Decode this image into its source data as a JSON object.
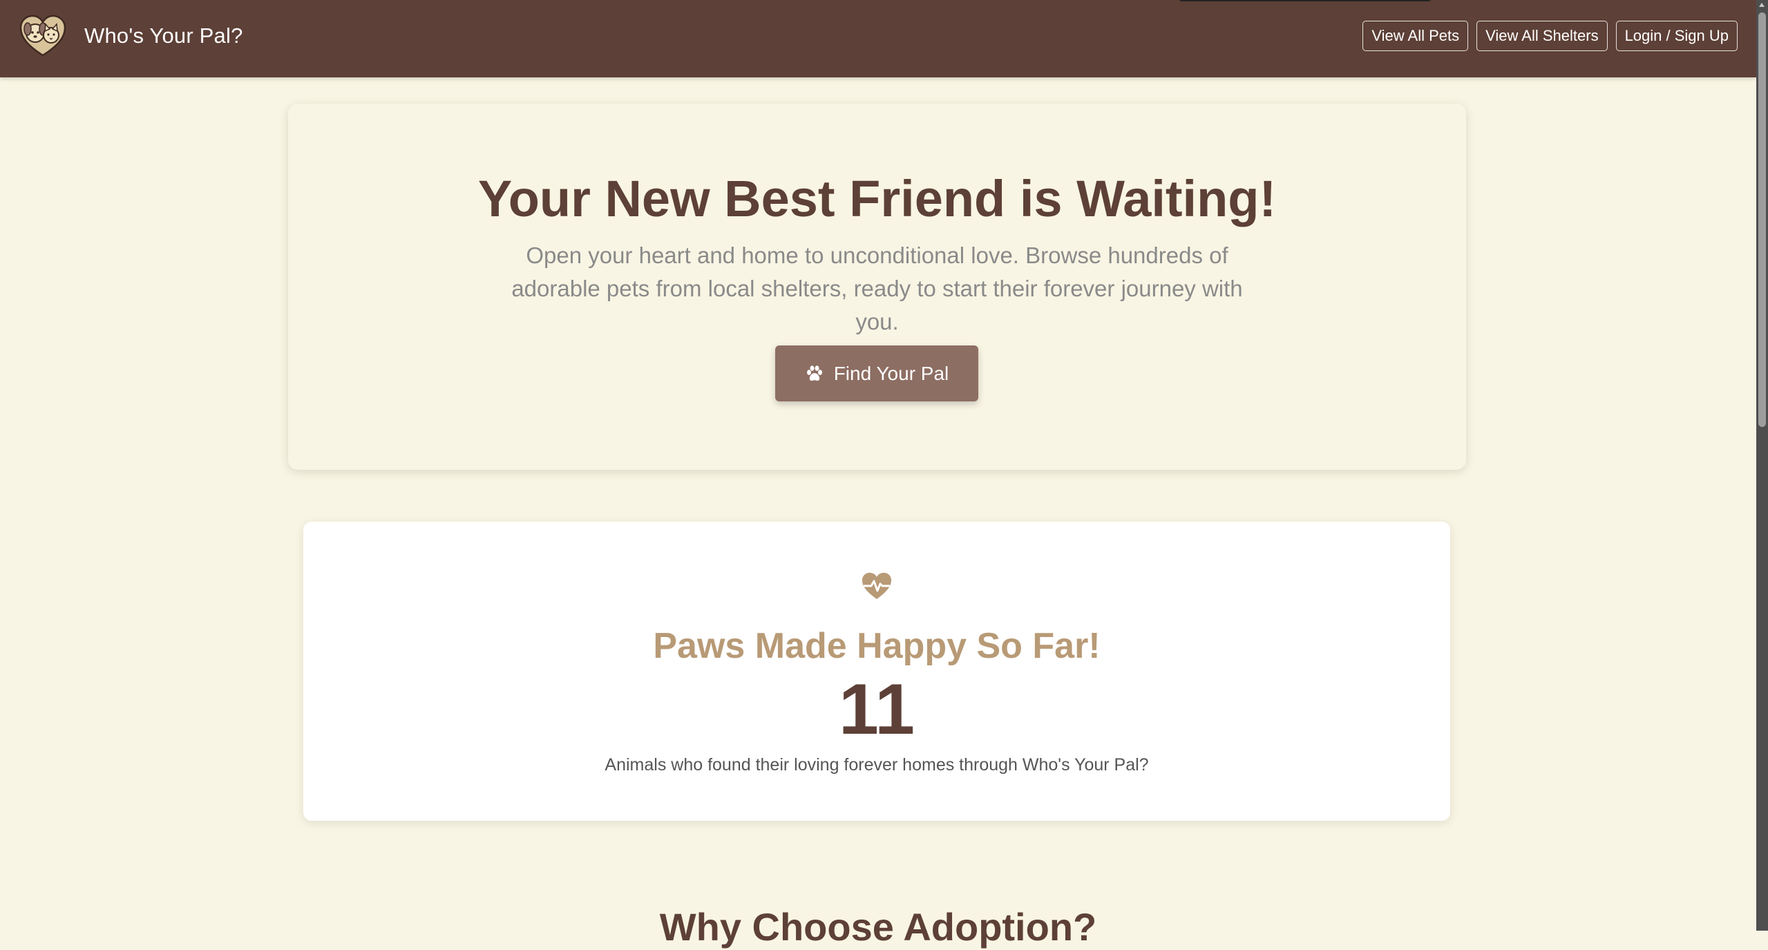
{
  "colors": {
    "navbar_bg": "#5d4037",
    "page_bg": "#f9f5e4",
    "primary_brown": "#5d4037",
    "cta_bg": "#8d6e63",
    "accent_tan": "#b89a76",
    "muted_text": "#8a8a8a"
  },
  "navbar": {
    "brand_title": "Who's Your Pal?",
    "logo_icon": "dog-cat-heart-logo",
    "buttons": {
      "view_all_pets": "View All Pets",
      "view_all_shelters": "View All Shelters",
      "login_signup": "Login / Sign Up"
    }
  },
  "hero": {
    "title": "Your New Best Friend is Waiting!",
    "subtitle": "Open your heart and home to unconditional love. Browse hundreds of adorable pets from local shelters, ready to start their forever journey with you.",
    "cta_label": "Find Your Pal",
    "cta_icon": "paw-icon"
  },
  "stats": {
    "icon": "heart-pulse-icon",
    "title": "Paws Made Happy So Far!",
    "count": "11",
    "caption": "Animals who found their loving forever homes through Who's Your Pal?"
  },
  "next_section": {
    "heading": "Why Choose Adoption?"
  }
}
